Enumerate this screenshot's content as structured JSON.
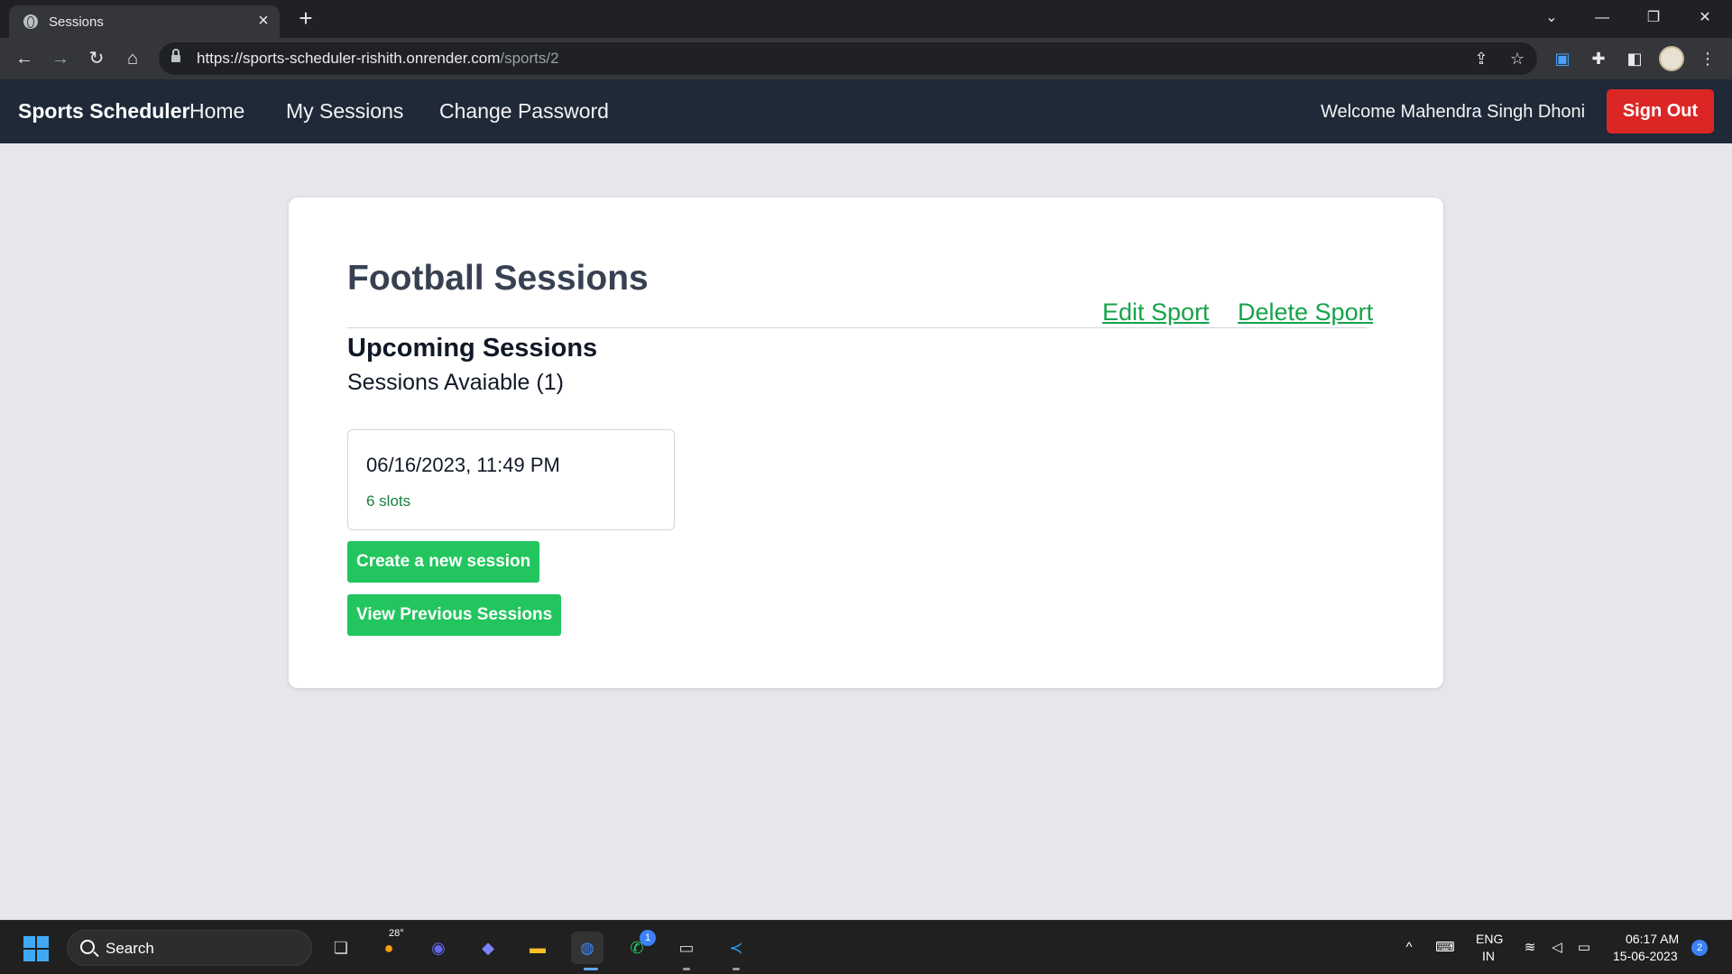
{
  "browser": {
    "tab_title": "Sessions",
    "url_host": "https://sports-scheduler-rishith.onrender.com",
    "url_path": "/sports/2"
  },
  "nav": {
    "brand": "Sports Scheduler",
    "links": [
      "Home",
      "My Sessions",
      "Change Password"
    ],
    "welcome": "Welcome Mahendra Singh Dhoni",
    "signout": "Sign Out"
  },
  "main": {
    "title": "Football Sessions",
    "edit_sport": "Edit Sport",
    "delete_sport": "Delete Sport",
    "upcoming_title": "Upcoming Sessions",
    "available": "Sessions Avaiable (1)",
    "sessions": [
      {
        "datetime": "06/16/2023, 11:49 PM",
        "slots": "6 slots"
      }
    ],
    "create_button": "Create a new session",
    "previous_button": "View Previous Sessions"
  },
  "taskbar": {
    "search_label": "Search",
    "weather_temp": "28°",
    "whatsapp_badge": "1",
    "language": "ENG",
    "region": "IN",
    "time": "06:17 AM",
    "date": "15-06-2023",
    "notification_count": "2"
  },
  "colors": {
    "nav_bg": "#1f2937",
    "accent_green": "#22c55e",
    "link_green": "#16a34a",
    "danger": "#dc2626",
    "page_bg": "#e5e7eb"
  }
}
